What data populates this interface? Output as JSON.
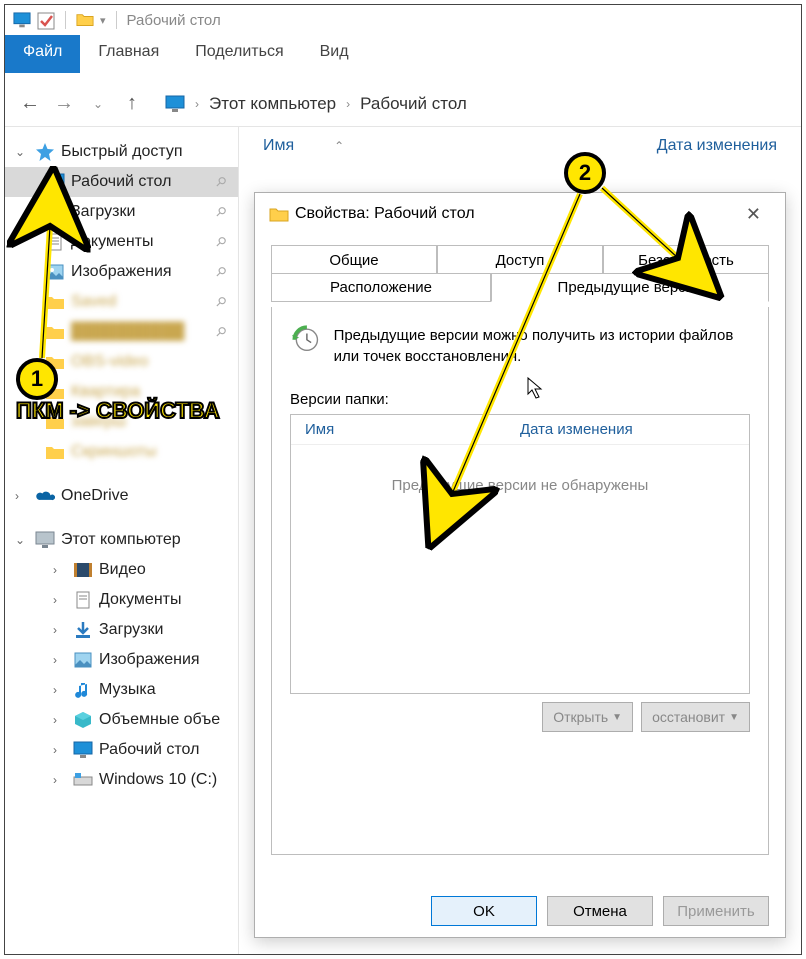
{
  "titlebar": {
    "title": "Рабочий стол"
  },
  "ribbon": {
    "file": "Файл",
    "home": "Главная",
    "share": "Поделиться",
    "view": "Вид"
  },
  "breadcrumb": {
    "root": "Этот компьютер",
    "current": "Рабочий стол"
  },
  "columns": {
    "name": "Имя",
    "date": "Дата изменения"
  },
  "sidebar": {
    "quick_access": "Быстрый доступ",
    "desktop": "Рабочий стол",
    "downloads": "Загрузки",
    "documents": "Документы",
    "pictures": "Изображения",
    "onedrive": "OneDrive",
    "this_pc": "Этот компьютер",
    "videos": "Видео",
    "documents2": "Документы",
    "downloads2": "Загрузки",
    "pictures2": "Изображения",
    "music": "Музыка",
    "objects3d": "Объемные объе",
    "desktop2": "Рабочий стол",
    "drive_c": "Windows 10 (C:)"
  },
  "dialog": {
    "title": "Свойства: Рабочий стол",
    "tabs": {
      "general": "Общие",
      "sharing": "Доступ",
      "security": "Безопасность",
      "location": "Расположение",
      "previous": "Предыдущие версии"
    },
    "info": "Предыдущие версии можно получить из истории файлов или точек восстановления.",
    "versions_label": "Версии папки:",
    "vheaders": {
      "name": "Имя",
      "date": "Дата изменения"
    },
    "empty": "Предыдущие версии не обнаружены",
    "open": "Открыть",
    "restore": "осстановит",
    "ok": "OK",
    "cancel": "Отмена",
    "apply": "Применить"
  },
  "annotation": {
    "badge1": "1",
    "badge2": "2",
    "text1": "ПКМ -> СВОЙСТВА"
  }
}
